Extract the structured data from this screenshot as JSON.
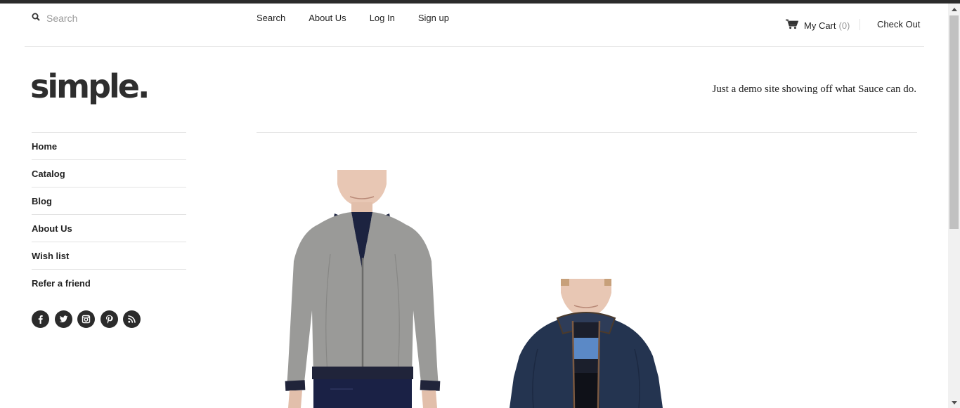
{
  "header": {
    "search": {
      "placeholder": "Search",
      "icon": "search-icon"
    },
    "nav": [
      {
        "label": "Search"
      },
      {
        "label": "About Us"
      },
      {
        "label": "Log In"
      },
      {
        "label": "Sign up"
      }
    ],
    "cart": {
      "label": "My Cart",
      "count": "(0)",
      "icon": "cart-icon"
    },
    "checkout_label": "Check Out"
  },
  "brand": {
    "logo": "simple.",
    "tagline": "Just a demo site showing off what Sauce can do."
  },
  "sidebar": {
    "items": [
      {
        "label": "Home"
      },
      {
        "label": "Catalog"
      },
      {
        "label": "Blog"
      },
      {
        "label": "About Us"
      },
      {
        "label": "Wish list"
      },
      {
        "label": "Refer a friend"
      }
    ],
    "social": [
      "facebook-icon",
      "twitter-icon",
      "instagram-icon",
      "pinterest-icon",
      "rss-icon"
    ]
  },
  "products": [
    {
      "name": "grey-bomber-jacket",
      "color": "#9a9a98"
    },
    {
      "name": "navy-jacket",
      "color": "#243450"
    }
  ],
  "colors": {
    "topbar": "#2b2b2b",
    "text": "#222222",
    "muted": "#999999",
    "divider": "#e2e2e2"
  }
}
